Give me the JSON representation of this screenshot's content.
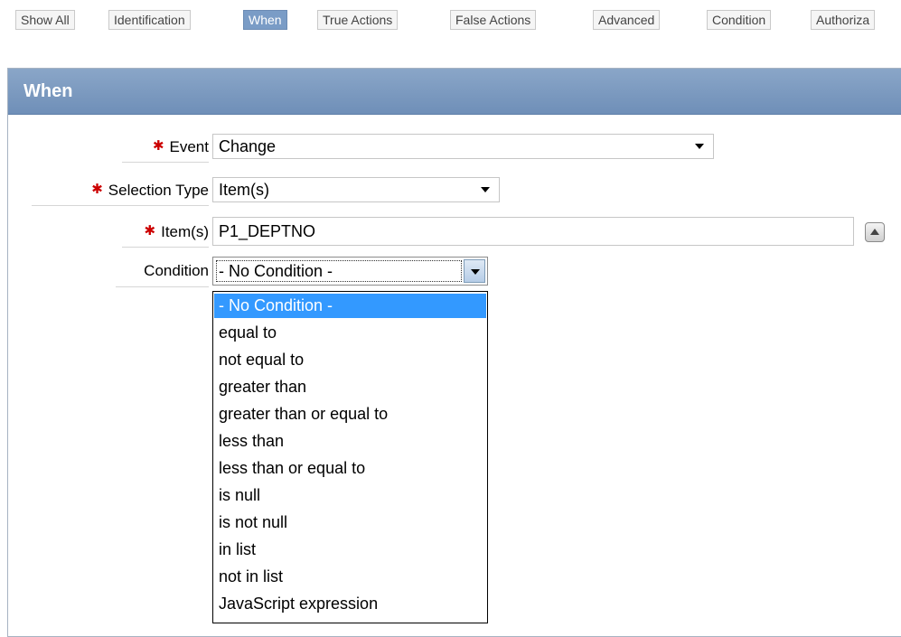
{
  "tabs": [
    {
      "label": "Show All"
    },
    {
      "label": "Identification"
    },
    {
      "label": "When",
      "active": true
    },
    {
      "label": "True Actions"
    },
    {
      "label": "False Actions"
    },
    {
      "label": "Advanced"
    },
    {
      "label": "Condition"
    },
    {
      "label": "Authoriza"
    }
  ],
  "region": {
    "title": "When"
  },
  "form": {
    "event": {
      "label": "Event",
      "value": "Change",
      "required": true
    },
    "selection_type": {
      "label": "Selection Type",
      "value": "Item(s)",
      "required": true
    },
    "items": {
      "label": "Item(s)",
      "value": "P1_DEPTNO",
      "required": true
    },
    "condition": {
      "label": "Condition",
      "value": "- No Condition -",
      "required": false
    }
  },
  "condition_options": [
    "- No Condition -",
    "equal to",
    "not equal to",
    "greater than",
    "greater than or equal to",
    "less than",
    "less than or equal to",
    "is null",
    "is not null",
    "in list",
    "not in list",
    "JavaScript expression"
  ],
  "required_marker": "✱",
  "colors": {
    "accent": "#7a9cc6",
    "selected_option": "#3399ff",
    "required": "#cc0000"
  }
}
